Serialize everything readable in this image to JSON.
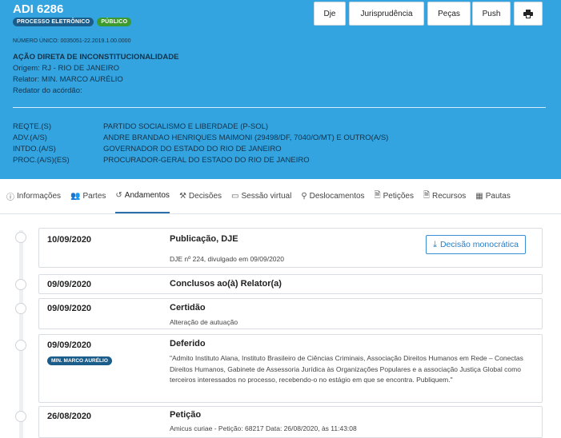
{
  "case": {
    "title": "ADI 6286",
    "badges": [
      "PROCESSO ELETRÔNICO",
      "PÚBLICO"
    ],
    "numero_unico": "NÚMERO ÚNICO: 0035051-22.2019.1.00.0000",
    "classe": "AÇÃO DIRETA DE INCONSTITUCIONALIDADE",
    "origem": "Origem: RJ - RIO DE JANEIRO",
    "relator": "Relator: MIN. MARCO AURÉLIO",
    "relator_acordao": "Redator do acórdão:"
  },
  "header_buttons": {
    "dje": "Dje",
    "jurisprudencia": "Jurisprudência",
    "pecas": "Peças",
    "push": "Push",
    "print_icon": "print-icon"
  },
  "parties": [
    {
      "role": "REQTE.(S)",
      "name": "PARTIDO SOCIALISMO E LIBERDADE (P-SOL)"
    },
    {
      "role": "ADV.(A/S)",
      "name": "ANDRE BRANDAO HENRIQUES MAIMONI (29498/DF, 7040/O/MT) E OUTRO(A/S)"
    },
    {
      "role": "INTDO.(A/S)",
      "name": "GOVERNADOR DO ESTADO DO RIO DE JANEIRO"
    },
    {
      "role": "PROC.(A/S)(ES)",
      "name": "PROCURADOR-GERAL DO ESTADO DO RIO DE JANEIRO"
    }
  ],
  "tabs": [
    {
      "label": "Informações",
      "icon": "info-icon",
      "glyph": "ⓘ"
    },
    {
      "label": "Partes",
      "icon": "users-icon",
      "glyph": "👥"
    },
    {
      "label": "Andamentos",
      "icon": "history-icon",
      "glyph": "↺"
    },
    {
      "label": "Decisões",
      "icon": "gavel-icon",
      "glyph": "⚒"
    },
    {
      "label": "Sessão virtual",
      "icon": "monitor-icon",
      "glyph": "▭"
    },
    {
      "label": "Deslocamentos",
      "icon": "map-marker-icon",
      "glyph": "⚲"
    },
    {
      "label": "Petições",
      "icon": "file-icon",
      "glyph": "🗎"
    },
    {
      "label": "Recursos",
      "icon": "file-icon",
      "glyph": "🗎"
    },
    {
      "label": "Pautas",
      "icon": "calendar-icon",
      "glyph": "▦"
    }
  ],
  "active_tab": "Andamentos",
  "timeline": [
    {
      "date": "10/09/2020",
      "title": "Publicação, DJE",
      "desc": "DJE nº 224, divulgado em 09/09/2020",
      "button": "Decisão monocrática"
    },
    {
      "date": "09/09/2020",
      "title": "Conclusos ao(à) Relator(a)",
      "desc": ""
    },
    {
      "date": "09/09/2020",
      "title": "Certidão",
      "desc": "Alteração de autuação"
    },
    {
      "date": "09/09/2020",
      "title": "Deferido",
      "badge": "MIN. MARCO AURÉLIO",
      "desc": "\"Admito Instituto Alana, Instituto Brasileiro de Ciências Criminais, Associação Direitos Humanos em Rede – Conectas Direitos Humanos, Gabinete de Assessoria Jurídica às Organizações Populares e a associação Justiça Global como terceiros interessados no processo, recebendo-o no estágio em que se encontra. Publiquem.\""
    },
    {
      "date": "26/08/2020",
      "title": "Petição",
      "desc": "Amicus curiae - Petição: 68217 Data: 26/08/2020, às 11:43:08"
    }
  ],
  "colors": {
    "header_bg": "#33a4e0",
    "badge_proc": "#1a5c8a",
    "badge_pub": "#3c9a2e",
    "link": "#2a7dc4"
  }
}
